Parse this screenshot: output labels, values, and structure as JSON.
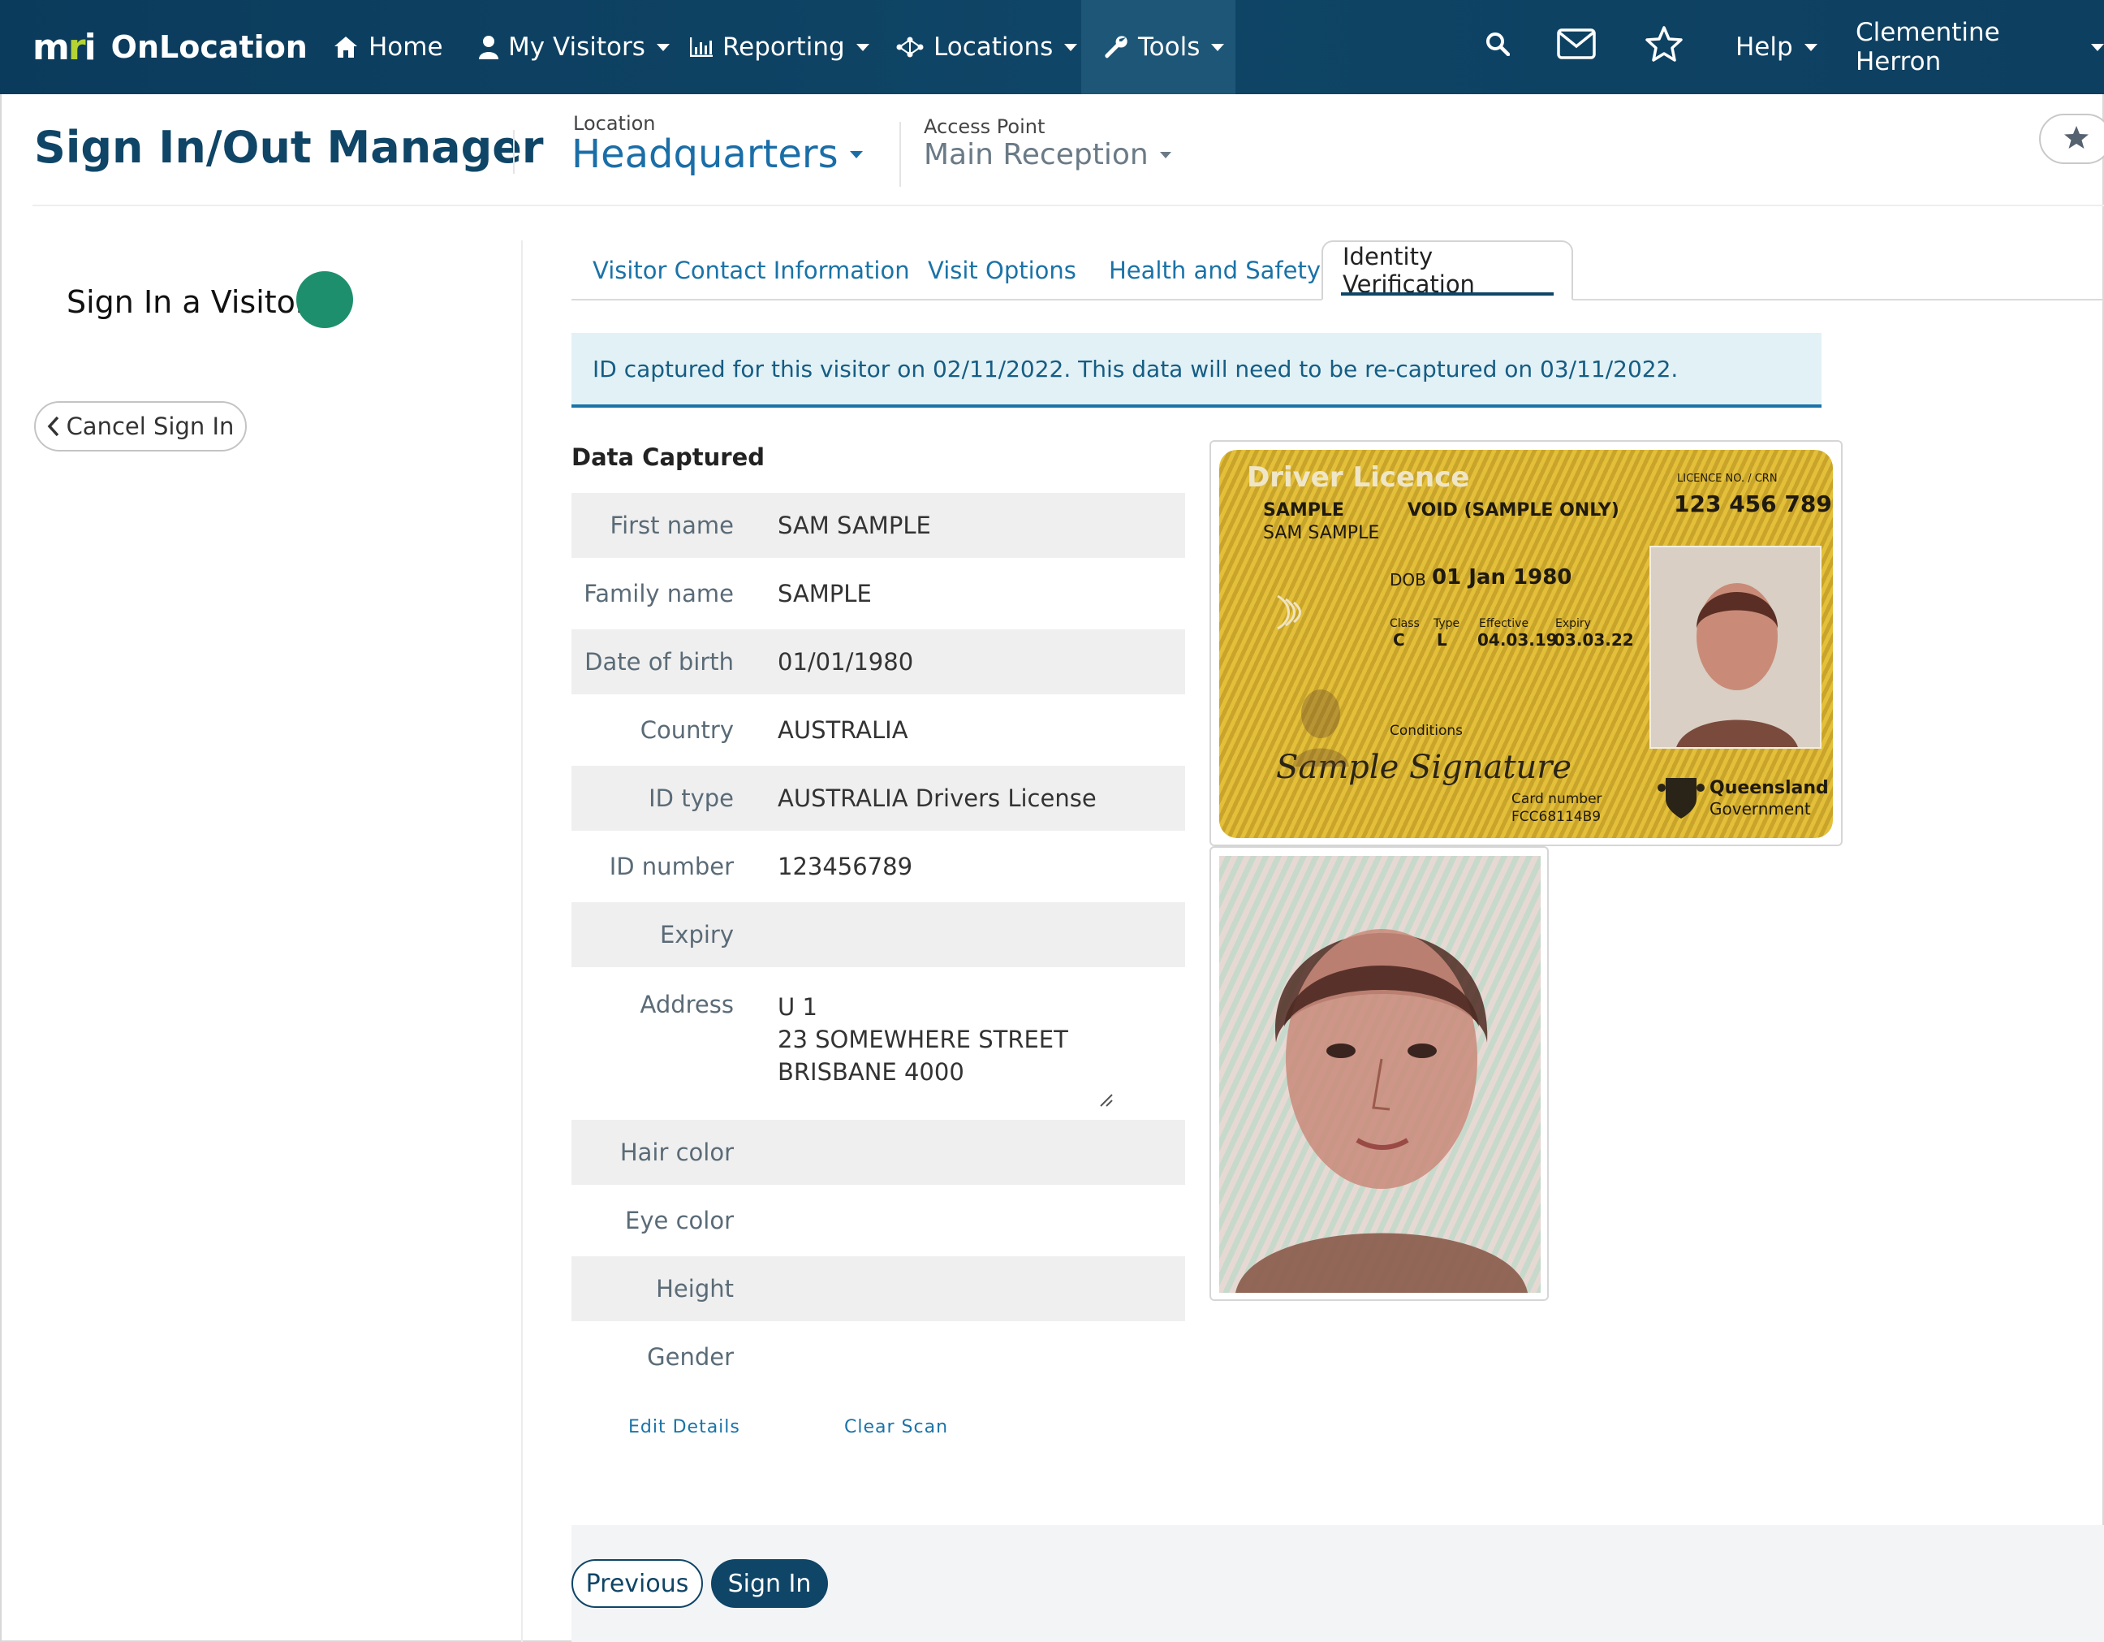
{
  "navbar": {
    "brand_mark": "mri",
    "brand_name": "OnLocation",
    "items": [
      {
        "label": "Home",
        "icon": "home-icon"
      },
      {
        "label": "My Visitors",
        "icon": "user-icon"
      },
      {
        "label": "Reporting",
        "icon": "bar-chart-icon"
      },
      {
        "label": "Locations",
        "icon": "network-icon"
      },
      {
        "label": "Tools",
        "icon": "wrench-icon"
      }
    ],
    "help_label": "Help",
    "user_name": "Clementine Herron"
  },
  "header": {
    "title": "Sign In/Out Manager",
    "location_label": "Location",
    "location_value": "Headquarters",
    "access_point_label": "Access Point",
    "access_point_value": "Main Reception"
  },
  "sidebar": {
    "heading": "Sign In a Visitor",
    "status_color": "#1d8f6c",
    "cancel_label": "Cancel Sign In"
  },
  "tabs": [
    {
      "label": "Visitor Contact Information",
      "active": false
    },
    {
      "label": "Visit Options",
      "active": false
    },
    {
      "label": "Health and Safety",
      "active": false
    },
    {
      "label": "Identity Verification",
      "active": true
    }
  ],
  "alert": {
    "text": "ID captured for this visitor on 02/11/2022. This data will need to be re-captured on 03/11/2022."
  },
  "data_captured": {
    "title": "Data Captured",
    "fields": [
      {
        "label": "First name",
        "value": "SAM SAMPLE"
      },
      {
        "label": "Family name",
        "value": "SAMPLE"
      },
      {
        "label": "Date of birth",
        "value": "01/01/1980"
      },
      {
        "label": "Country",
        "value": "AUSTRALIA"
      },
      {
        "label": "ID type",
        "value": "AUSTRALIA Drivers License"
      },
      {
        "label": "ID number",
        "value": "123456789"
      },
      {
        "label": "Expiry",
        "value": ""
      }
    ],
    "address": {
      "label": "Address",
      "lines": [
        "U 1",
        "23 SOMEWHERE STREET",
        "BRISBANE 4000"
      ]
    },
    "extra_fields": [
      {
        "label": "Hair color",
        "value": ""
      },
      {
        "label": "Eye color",
        "value": ""
      },
      {
        "label": "Height",
        "value": ""
      },
      {
        "label": "Gender",
        "value": ""
      }
    ],
    "edit_label": "Edit Details",
    "clear_label": "Clear Scan"
  },
  "id_card": {
    "title": "Driver Licence",
    "name_line1": "SAMPLE",
    "name_line2": "SAM SAMPLE",
    "void_text": "VOID (SAMPLE ONLY)",
    "licence_no_label": "LICENCE NO. / CRN",
    "licence_no": "123 456 789",
    "dob_label": "DOB",
    "dob": "01 Jan 1980",
    "class_label": "Class",
    "class_value": "C",
    "type_label": "Type",
    "type_value": "L",
    "effective_label": "Effective",
    "effective_value": "04.03.19",
    "expiry_label": "Expiry",
    "expiry_value": "03.03.22",
    "conditions_label": "Conditions",
    "signature": "Sample Signature",
    "card_number_label": "Card number",
    "card_number": "FCC68114B9",
    "issuer_line1": "Queensland",
    "issuer_line2": "Government"
  },
  "footer": {
    "previous_label": "Previous",
    "sign_in_label": "Sign In"
  },
  "colors": {
    "nav_bg": "#0f4566",
    "accent_link": "#1a73a8",
    "status_green": "#1d8f6c",
    "logo_accent": "#b5d334"
  }
}
